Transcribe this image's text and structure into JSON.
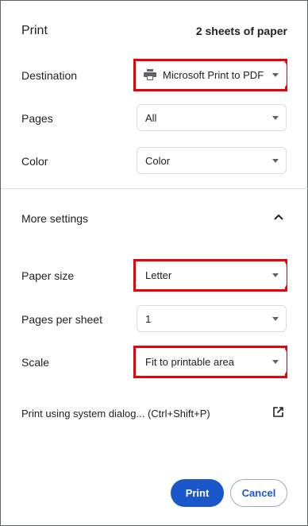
{
  "header": {
    "title": "Print",
    "sheet_count": "2 sheets of paper"
  },
  "destination": {
    "label": "Destination",
    "value": "Microsoft Print to PDF",
    "icon": "printer-icon"
  },
  "pages": {
    "label": "Pages",
    "value": "All"
  },
  "color": {
    "label": "Color",
    "value": "Color"
  },
  "more_settings": {
    "label": "More settings",
    "icon": "chevron-up-icon"
  },
  "paper_size": {
    "label": "Paper size",
    "value": "Letter"
  },
  "pages_per_sheet": {
    "label": "Pages per sheet",
    "value": "1"
  },
  "scale": {
    "label": "Scale",
    "value": "Fit to printable area"
  },
  "system_dialog": {
    "label": "Print using system dialog... (Ctrl+Shift+P)",
    "icon": "external-link-icon"
  },
  "actions": {
    "print_label": "Print",
    "cancel_label": "Cancel"
  },
  "colors": {
    "accent": "#1a57c9",
    "highlight": "#e8000b"
  }
}
